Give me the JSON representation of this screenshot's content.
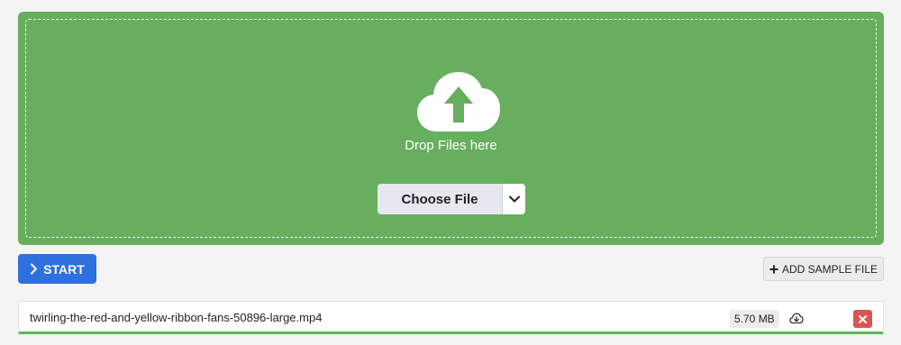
{
  "dropzone": {
    "background_color": "#68ae5f",
    "icon": "cloud-upload-icon",
    "drop_text": "Drop Files here",
    "choose_label": "Choose File",
    "dropdown_icon": "chevron-down-icon"
  },
  "actions": {
    "start_label": "START",
    "start_icon": "chevron-right-icon",
    "start_color": "#2f6fde",
    "sample_label": "ADD SAMPLE FILE",
    "sample_icon": "plus-icon"
  },
  "files": [
    {
      "name": "twirling-the-red-and-yellow-ribbon-fans-50896-large.mp4",
      "size": "5.70 MB",
      "progress": 1.0,
      "progress_color": "#5cb85c"
    }
  ]
}
